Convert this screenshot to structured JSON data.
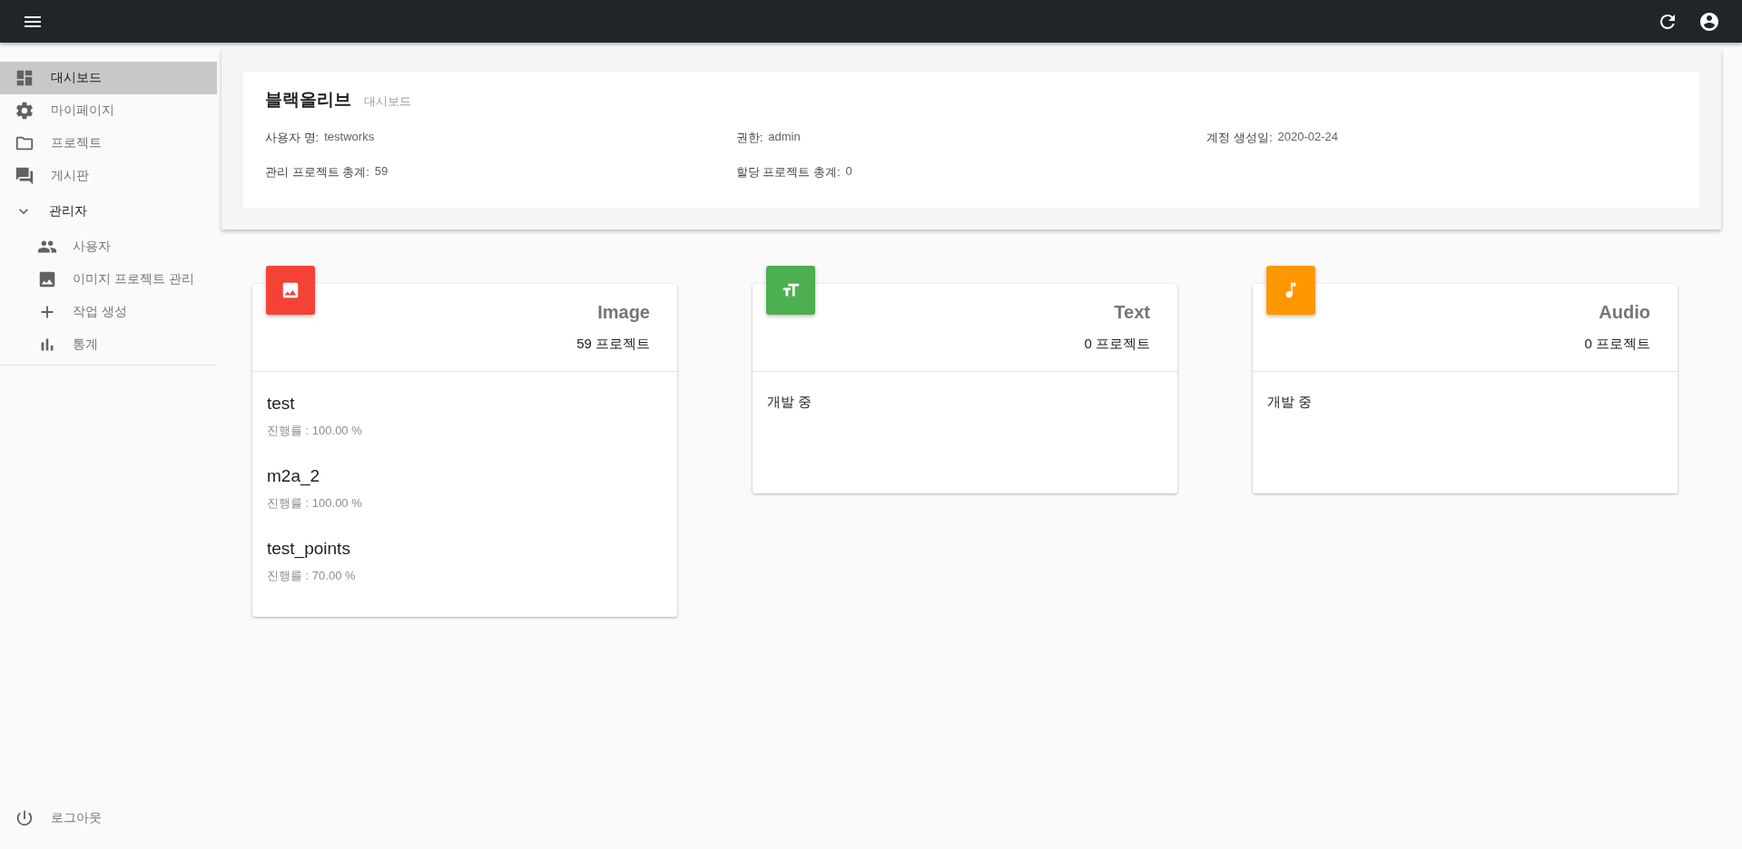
{
  "sidebar": {
    "items": [
      {
        "label": "대시보드",
        "selected": true
      },
      {
        "label": "마이페이지",
        "selected": false
      },
      {
        "label": "프로젝트",
        "selected": false
      },
      {
        "label": "게시판",
        "selected": false
      }
    ],
    "group": {
      "label": "관리자",
      "expanded": true,
      "children": [
        {
          "label": "사용자",
          "selected": false
        },
        {
          "label": "이미지 프로젝트 관리",
          "selected": false
        },
        {
          "label": "작업 생성",
          "selected": false
        },
        {
          "label": "통계",
          "selected": false
        }
      ]
    },
    "logout": "로그아웃"
  },
  "profile": {
    "title": "블랙올리브",
    "subtitle": "대시보드",
    "fields": [
      {
        "label": "사용자 명:",
        "value": "testworks"
      },
      {
        "label": "권한:",
        "value": "admin"
      },
      {
        "label": "계정 생성일:",
        "value": "2020-02-24"
      },
      {
        "label": "관리 프로젝트 총계:",
        "value": "59"
      },
      {
        "label": "할당 프로젝트 총계:",
        "value": "0"
      }
    ]
  },
  "cards": [
    {
      "kind": "image",
      "color": "#f44336",
      "title": "Image",
      "count": "59 프로젝트",
      "projects": [
        {
          "name": "test",
          "progress": "진행률 : 100.00 %"
        },
        {
          "name": "m2a_2",
          "progress": "진행률 : 100.00 %"
        },
        {
          "name": "test_points",
          "progress": "진행률 : 70.00 %"
        }
      ]
    },
    {
      "kind": "text",
      "color": "#4caf50",
      "title": "Text",
      "count": "0 프로젝트",
      "message": "개발 중"
    },
    {
      "kind": "audio",
      "color": "#ff9800",
      "title": "Audio",
      "count": "0 프로젝트",
      "message": "개발 중"
    }
  ]
}
